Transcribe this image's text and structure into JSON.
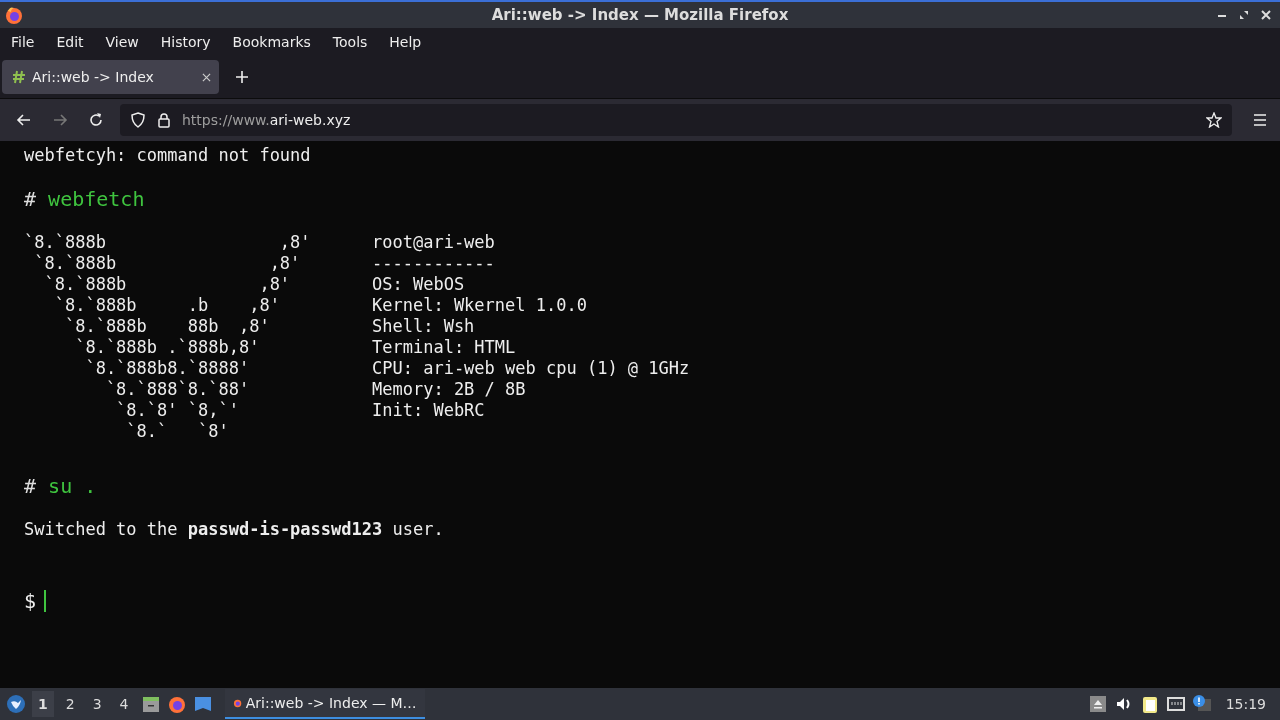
{
  "window": {
    "title": "Ari::web -> Index — Mozilla Firefox"
  },
  "menu": [
    "File",
    "Edit",
    "View",
    "History",
    "Bookmarks",
    "Tools",
    "Help"
  ],
  "tabs": [
    {
      "label": "Ari::web -> Index",
      "selected": true
    }
  ],
  "address_bar": {
    "url_prefix": "https://www.",
    "url_domain": "ari-web.xyz"
  },
  "terminal": {
    "error_line": "webfetcyh: command not found",
    "commands": [
      {
        "prompt": "#",
        "text": "webfetch"
      },
      {
        "prompt": "#",
        "text": "su ."
      }
    ],
    "ascii_art": [
      "`8.`888b                 ,8'",
      " `8.`888b               ,8'",
      "  `8.`888b             ,8'",
      "   `8.`888b     .b    ,8'",
      "    `8.`888b    88b  ,8'",
      "     `8.`888b .`888b,8'",
      "      `8.`888b8.`8888'",
      "        `8.`888`8.`88'",
      "         `8.`8' `8,`'",
      "          `8.`   `8'"
    ],
    "info": [
      "root@ari-web",
      "------------",
      "OS: WebOS",
      "Kernel: Wkernel 1.0.0",
      "Shell: Wsh",
      "Terminal: HTML",
      "CPU: ari-web web cpu (1) @ 1GHz",
      "Memory: 2B / 8B",
      "Init: WebRC"
    ],
    "message": "Switched to the **passwd-is-passwd123** user.",
    "input_prompt": "$"
  },
  "taskbar": {
    "workspaces": [
      {
        "label": "1",
        "selected": true
      },
      {
        "label": "2",
        "selected": false
      },
      {
        "label": "3",
        "selected": false
      },
      {
        "label": "4",
        "selected": false
      }
    ],
    "task": {
      "label": "Ari::web -> Index — M…",
      "selected": true
    },
    "clock": "15:19"
  }
}
